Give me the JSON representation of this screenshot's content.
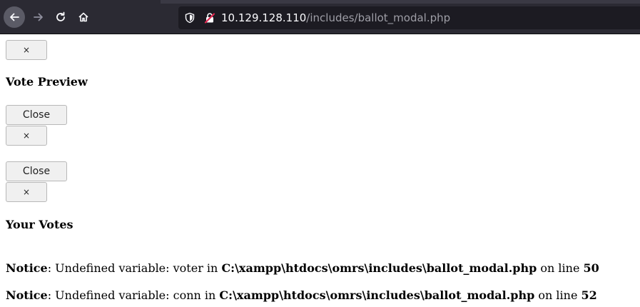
{
  "browser": {
    "url_host": "10.129.128.110",
    "url_path": "/includes/ballot_modal.php"
  },
  "page": {
    "close_x_label": "×",
    "vote_preview_heading": "Vote Preview",
    "close_label": "Close",
    "your_votes_heading": "Your Votes",
    "notices": [
      {
        "label": "Notice",
        "message": ": Undefined variable: voter in ",
        "file": "C:\\xampp\\htdocs\\omrs\\includes\\ballot_modal.php",
        "on_line": " on line ",
        "line": "50"
      },
      {
        "label": "Notice",
        "message": ": Undefined variable: conn in ",
        "file": "C:\\xampp\\htdocs\\omrs\\includes\\ballot_modal.php",
        "on_line": " on line ",
        "line": "52"
      }
    ]
  }
}
